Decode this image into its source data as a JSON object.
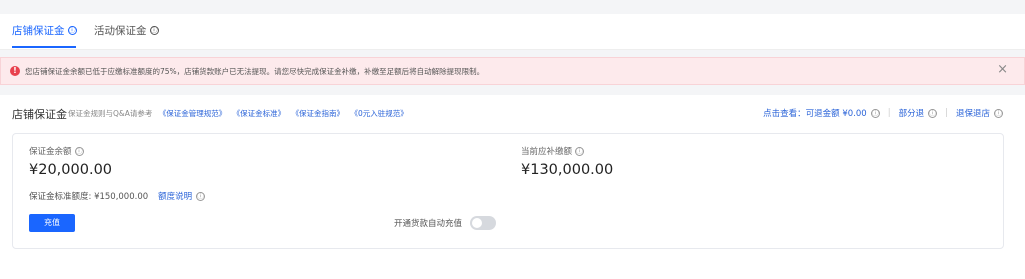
{
  "tabs": [
    {
      "label": "店铺保证金",
      "active": true
    },
    {
      "label": "活动保证金",
      "active": false
    }
  ],
  "icons": {
    "info": "ⓘ",
    "alert": "!",
    "close": "×"
  },
  "alert": {
    "text": "您店铺保证金余额已低于应缴标准额度的75%，店铺货款账户已无法提现。请您尽快完成保证金补缴，补缴至足额后将自动解除提现限制。"
  },
  "section": {
    "title": "店铺保证金",
    "meta_prefix": "保证金规则与Q&A请参考",
    "links": [
      "《保证金管理规范》",
      "《保证金标准》",
      "《保证金指南》",
      "《0元入驻规范》"
    ],
    "view_label": "点击查看：可退金额 ¥0.00",
    "partial_refund": "部分退",
    "full_refund": "退保退店"
  },
  "balance": {
    "label": "保证金余额",
    "value": "¥20,000.00",
    "standard_text": "保证金标准额度: ¥150,000.00",
    "quota_link": "额度说明",
    "recharge_button": "充值"
  },
  "to_pay": {
    "label": "当前应补缴额",
    "value": "¥130,000.00"
  },
  "auto_recharge": {
    "label": "开通货款自动充值",
    "enabled": false
  },
  "colors": {
    "accent": "#1a66ff",
    "link": "#2a63d8",
    "alert_bg": "#fdeaec",
    "alert_icon": "#e8414e"
  }
}
